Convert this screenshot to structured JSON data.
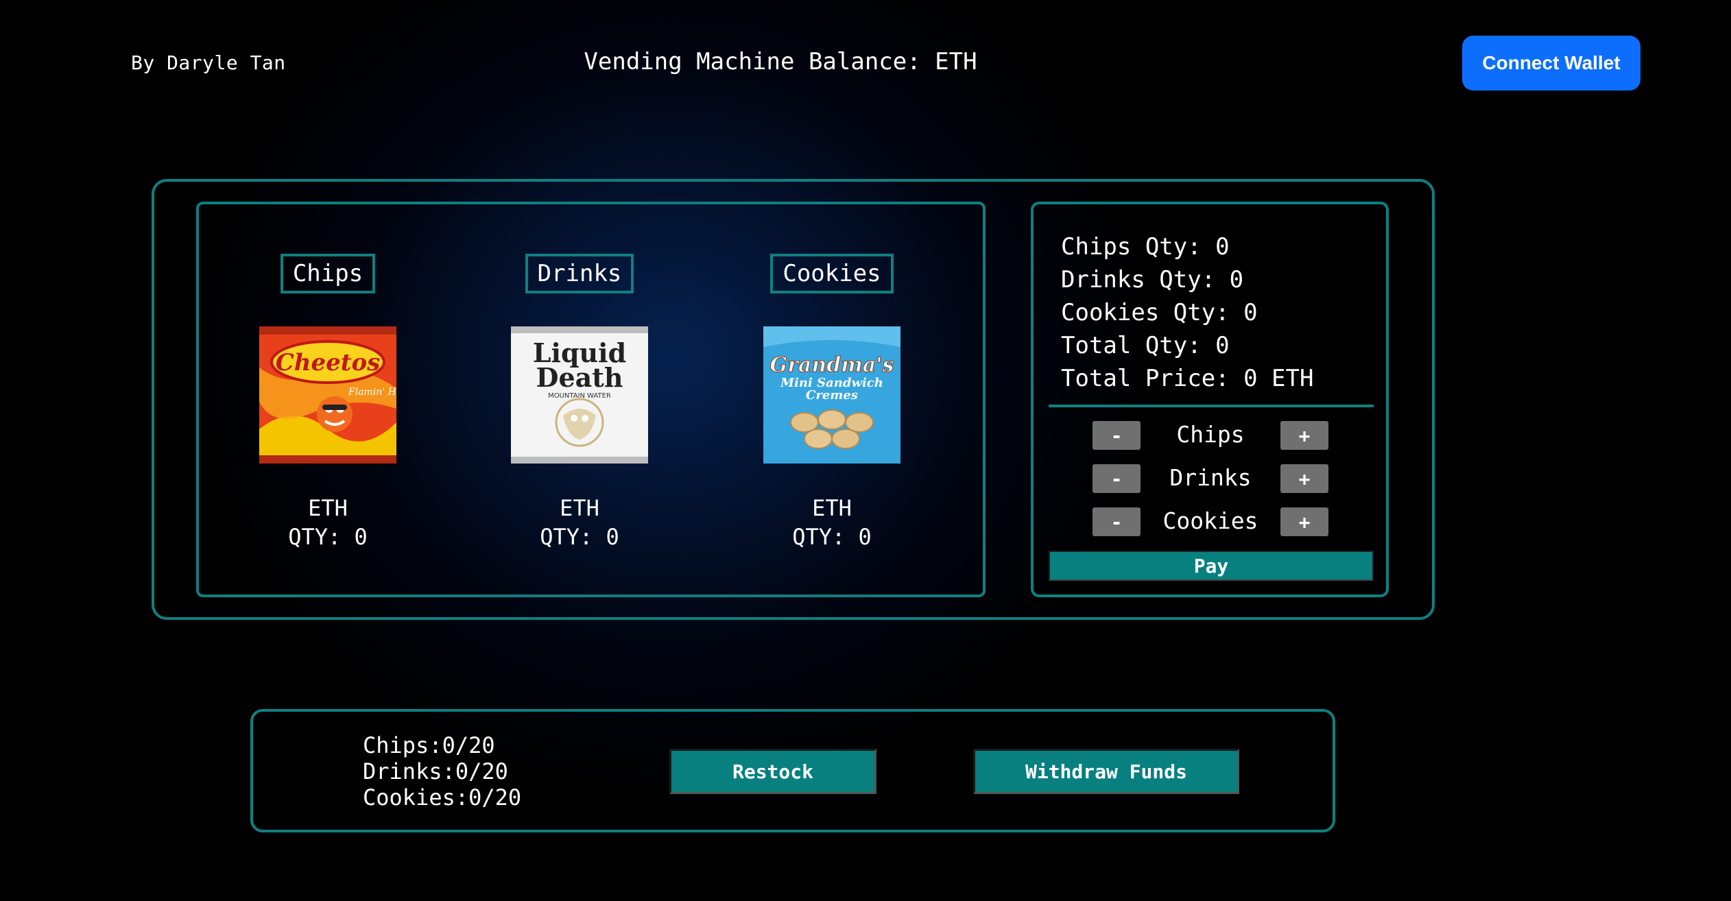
{
  "header": {
    "author": "By Daryle Tan",
    "balance": "Vending Machine Balance: ETH",
    "connect_label": "Connect Wallet"
  },
  "products": [
    {
      "name": "Chips",
      "price": "ETH",
      "qty": "QTY: 0",
      "icon": "cheetos-bag-image"
    },
    {
      "name": "Drinks",
      "price": "ETH",
      "qty": "QTY: 0",
      "icon": "liquid-death-can-image"
    },
    {
      "name": "Cookies",
      "price": "ETH",
      "qty": "QTY: 0",
      "icon": "grandmas-cookies-bag-image"
    }
  ],
  "cart": {
    "chips_qty": "Chips Qty: 0",
    "drinks_qty": "Drinks Qty: 0",
    "cookies_qty": "Cookies Qty: 0",
    "total_qty": "Total Qty: 0",
    "total_price": "Total Price: 0 ETH",
    "rows": [
      {
        "minus": "-",
        "label": "Chips",
        "plus": "+"
      },
      {
        "minus": "-",
        "label": "Drinks",
        "plus": "+"
      },
      {
        "minus": "-",
        "label": "Cookies",
        "plus": "+"
      }
    ],
    "pay_label": "Pay"
  },
  "admin": {
    "stock": [
      {
        "label": "Chips:",
        "value": "0/20"
      },
      {
        "label": "Drinks:",
        "value": "0/20"
      },
      {
        "label": "Cookies:",
        "value": "0/20"
      }
    ],
    "restock_label": "Restock",
    "withdraw_label": "Withdraw Funds"
  },
  "colors": {
    "accent": "#0e8080",
    "button_teal": "#088080",
    "connect_blue": "#0d6efd",
    "adjust_gray": "#707070"
  }
}
